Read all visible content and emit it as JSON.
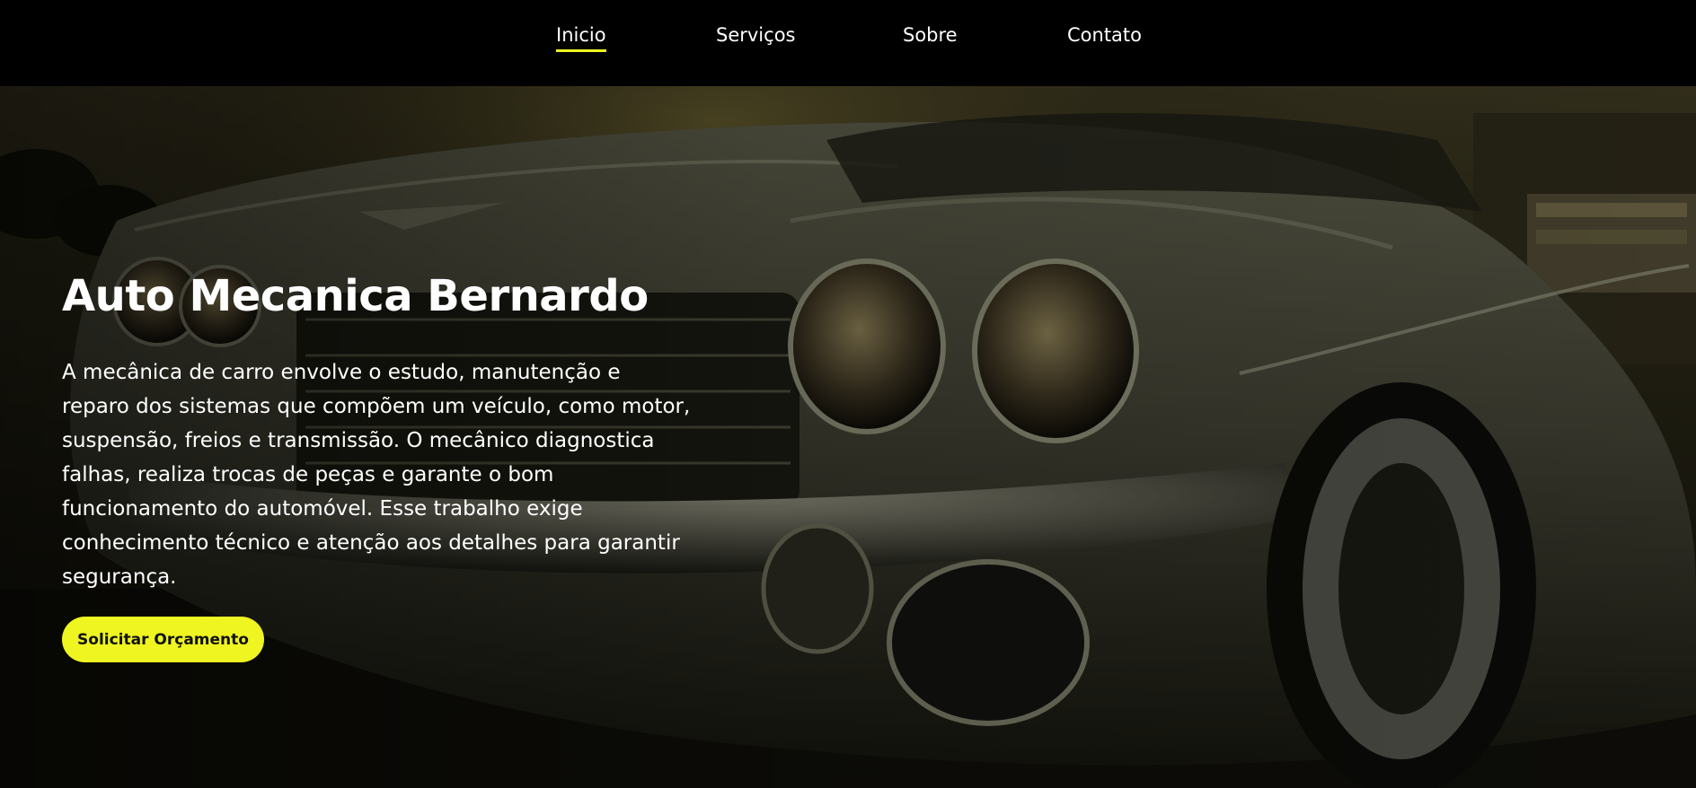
{
  "nav": {
    "items": [
      {
        "label": "Inicio",
        "active": true
      },
      {
        "label": "Serviços",
        "active": false
      },
      {
        "label": "Sobre",
        "active": false
      },
      {
        "label": "Contato",
        "active": false
      }
    ]
  },
  "hero": {
    "title": "Auto Mecanica Bernardo",
    "description": "A mecânica de carro envolve o estudo, manutenção e reparo dos sistemas que compõem um veículo, como motor, suspensão, freios e transmissão. O mecânico diagnostica falhas, realiza trocas de peças e garante o bom funcionamento do automóvel. Esse trabalho exige conhecimento técnico e atenção aos detalhes para garantir segurança.",
    "cta_label": "Solicitar Orçamento"
  },
  "colors": {
    "accent": "#eef520",
    "nav_background": "#000000",
    "text": "#ffffff"
  }
}
